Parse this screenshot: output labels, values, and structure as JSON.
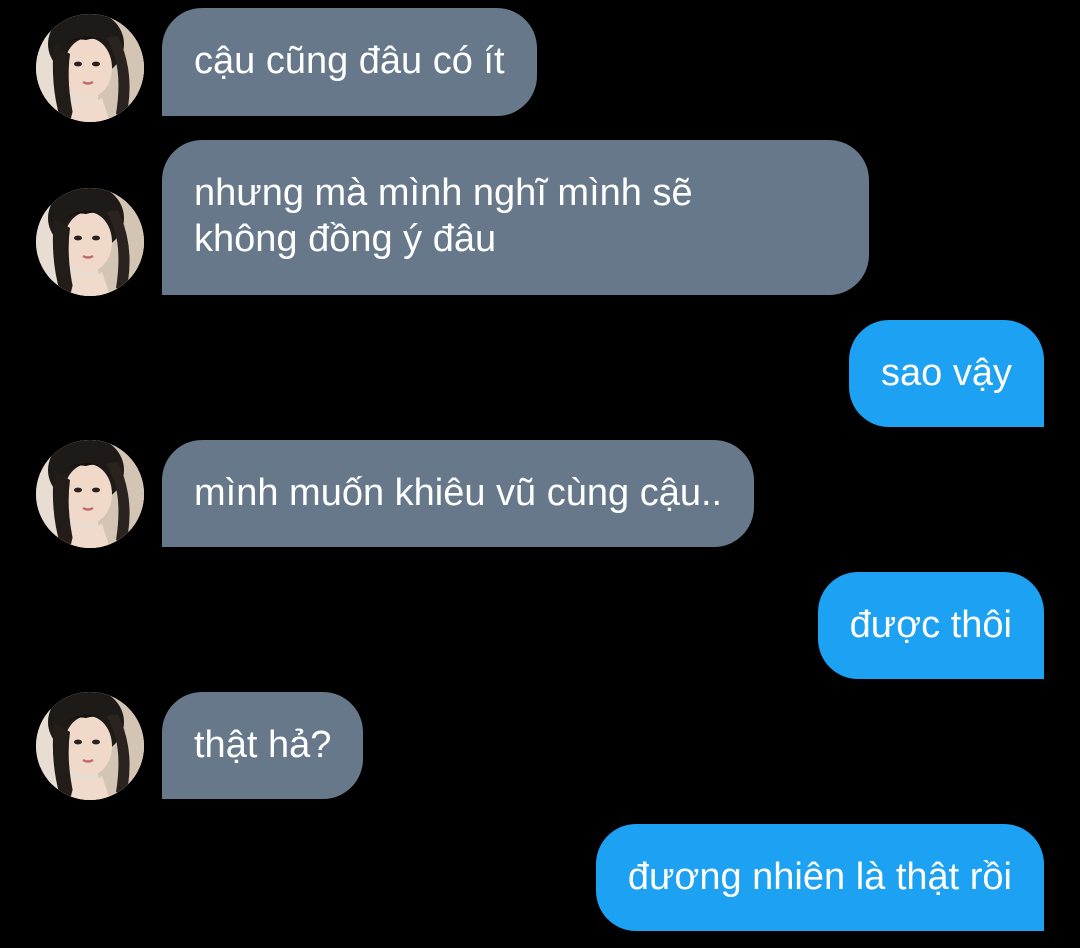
{
  "theme": {
    "background": "#000000",
    "incoming_bubble": "#66788a",
    "outgoing_bubble": "#1da1f2",
    "text": "#ffffff"
  },
  "messages": [
    {
      "sender": "other",
      "text": "cậu cũng đâu có ít",
      "avatar": "profile-photo"
    },
    {
      "sender": "other",
      "text": "nhưng mà mình nghĩ mình sẽ\nkhông đồng ý đâu",
      "avatar": "profile-photo"
    },
    {
      "sender": "self",
      "text": "sao vậy"
    },
    {
      "sender": "other",
      "text": "mình muốn khiêu vũ cùng cậu..",
      "avatar": "profile-photo"
    },
    {
      "sender": "self",
      "text": "được thôi"
    },
    {
      "sender": "other",
      "text": "thật hả?",
      "avatar": "profile-photo"
    },
    {
      "sender": "self",
      "text": "đương nhiên là thật rồi"
    }
  ]
}
